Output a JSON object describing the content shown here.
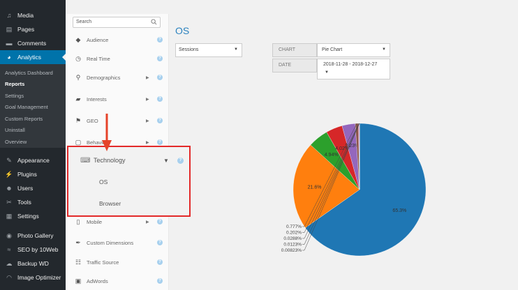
{
  "wp_sidebar": {
    "items": [
      {
        "label": "Media",
        "icon": "media-icon",
        "glyph": "♫"
      },
      {
        "label": "Pages",
        "icon": "pages-icon",
        "glyph": "▤"
      },
      {
        "label": "Comments",
        "icon": "comments-icon",
        "glyph": "▬"
      },
      {
        "label": "Analytics",
        "icon": "analytics-icon",
        "glyph": "◕"
      },
      {
        "label": "Appearance",
        "icon": "appearance-icon",
        "glyph": "✎"
      },
      {
        "label": "Plugins",
        "icon": "plugins-icon",
        "glyph": "⚡"
      },
      {
        "label": "Users",
        "icon": "users-icon",
        "glyph": "☻"
      },
      {
        "label": "Tools",
        "icon": "tools-icon",
        "glyph": "✂"
      },
      {
        "label": "Settings",
        "icon": "settings-icon",
        "glyph": "▦"
      },
      {
        "label": "Photo Gallery",
        "icon": "photo-gallery-icon",
        "glyph": "◉"
      },
      {
        "label": "SEO by 10Web",
        "icon": "seo-icon",
        "glyph": "≈"
      },
      {
        "label": "Backup WD",
        "icon": "backup-icon",
        "glyph": "☁"
      },
      {
        "label": "Image Optimizer",
        "icon": "image-optimizer-icon",
        "glyph": "◠"
      }
    ],
    "submenu": [
      "Analytics Dashboard",
      "Reports",
      "Settings",
      "Goal Management",
      "Custom Reports",
      "Uninstall",
      "Overview"
    ]
  },
  "report_menu": {
    "search_placeholder": "Search",
    "items": [
      {
        "label": "Audience",
        "icon": "audience-icon",
        "glyph": "◆"
      },
      {
        "label": "Real Time",
        "icon": "real-time-icon",
        "glyph": "◷"
      },
      {
        "label": "Demographics",
        "icon": "demographics-icon",
        "glyph": "⚲"
      },
      {
        "label": "Interests",
        "icon": "interests-icon",
        "glyph": "▰"
      },
      {
        "label": "GEO",
        "icon": "geo-icon",
        "glyph": "⚑"
      },
      {
        "label": "Behavior",
        "icon": "behavior-icon",
        "glyph": "▢"
      },
      {
        "label": "Mobile",
        "icon": "mobile-icon",
        "glyph": "▯"
      },
      {
        "label": "Custom Dimensions",
        "icon": "custom-dimensions-icon",
        "glyph": "✒"
      },
      {
        "label": "Traffic Source",
        "icon": "traffic-source-icon",
        "glyph": "☷"
      },
      {
        "label": "AdWords",
        "icon": "adwords-icon",
        "glyph": "▣"
      }
    ],
    "technology": {
      "label": "Technology",
      "icon": "technology-icon",
      "glyph": "⌨",
      "subitems": [
        "OS",
        "Browser"
      ]
    }
  },
  "main": {
    "title": "OS",
    "metric_select": "Sessions",
    "chart_label": "CHART",
    "chart_value": "Pie Chart",
    "date_label": "DATE",
    "date_value": "2018-11-28 - 2018-12-27"
  },
  "chart_data": {
    "type": "pie",
    "title": "",
    "slices": [
      {
        "label": "65.3%",
        "value": 65.3,
        "color": "#1f77b4"
      },
      {
        "label": "21.6%",
        "value": 21.6,
        "color": "#ff7f0e"
      },
      {
        "label": "4.94%",
        "value": 4.94,
        "color": "#2ca02c"
      },
      {
        "label": "4.02%",
        "value": 4.02,
        "color": "#d62728"
      },
      {
        "label": "3.23%",
        "value": 3.23,
        "color": "#9467bd"
      },
      {
        "label": "0.777%",
        "value": 0.777,
        "color": "#8c564b"
      },
      {
        "label": "0.202%",
        "value": 0.202,
        "color": "#e377c2"
      },
      {
        "label": "0.0288%",
        "value": 0.0288,
        "color": "#7f7f7f"
      },
      {
        "label": "0.0123%",
        "value": 0.0123,
        "color": "#bcbd22"
      },
      {
        "label": "0.00823%",
        "value": 0.00823,
        "color": "#17becf"
      }
    ]
  }
}
